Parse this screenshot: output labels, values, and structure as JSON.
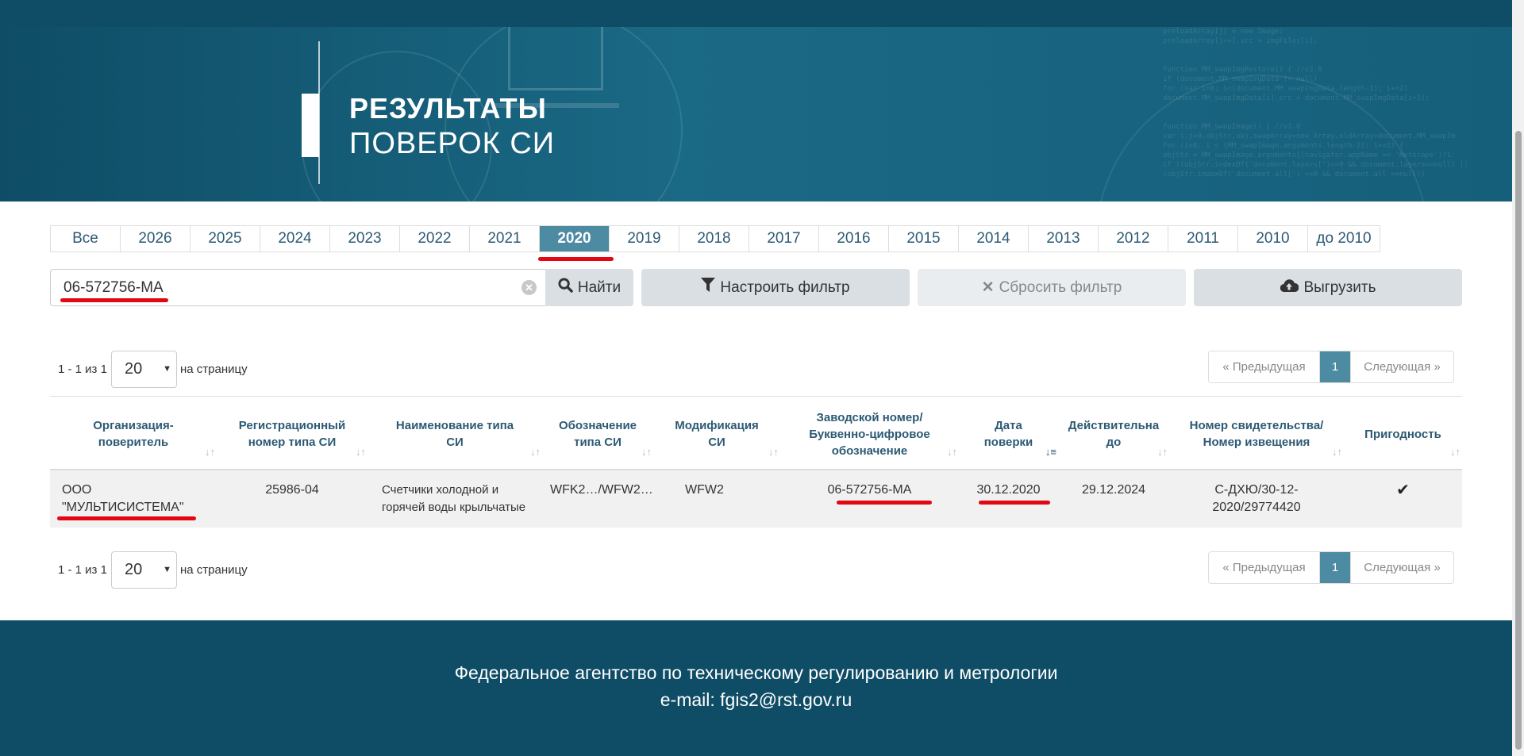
{
  "hero": {
    "title_line1": "РЕЗУЛЬТАТЫ",
    "title_line2": "ПОВЕРОК СИ"
  },
  "years": [
    "Все",
    "2026",
    "2025",
    "2024",
    "2023",
    "2022",
    "2021",
    "2020",
    "2019",
    "2018",
    "2017",
    "2016",
    "2015",
    "2014",
    "2013",
    "2012",
    "2011",
    "2010",
    "до 2010"
  ],
  "active_year": "2020",
  "search": {
    "value": "06-572756-МА",
    "find_label": "Найти"
  },
  "buttons": {
    "filter": "Настроить фильтр",
    "reset": "Сбросить фильтр",
    "export": "Выгрузить"
  },
  "pagination": {
    "count": "1 - 1 из 1",
    "page_size": "20",
    "per_page": "на страницу",
    "prev": "Предыдущая",
    "page": "1",
    "next": "Следующая"
  },
  "table": {
    "headers": [
      "Организация-\nповеритель",
      "Регистрационный\nномер типа СИ",
      "Наименование типа\nСИ",
      "Обозначение\nтипа СИ",
      "Модификация\nСИ",
      "Заводской номер/\nБуквенно-цифровое\nобозначение",
      "Дата\nповерки",
      "Действительна\nдо",
      "Номер свидетельства/\nНомер извещения",
      "Пригодность"
    ],
    "rows": [
      {
        "org": "ООО\n\"МУЛЬТИСИСТЕМА\"",
        "reg_number": "25986-04",
        "type_name": "Счетчики холодной и\nгорячей воды крыльчатые",
        "designation": "WFK2…/WFW2…",
        "modification": "WFW2",
        "serial": "06-572756-МА",
        "date": "30.12.2020",
        "valid_until": "29.12.2024",
        "certificate": "С-ДХЮ/30-12-\n2020/29774420",
        "suitable": "✔"
      }
    ]
  },
  "footer": {
    "line1": "Федеральное агентство по техническому регулированию и метрологии",
    "line2": "e-mail: fgis2@rst.gov.ru"
  },
  "colors": {
    "primary": "#0f4d66",
    "accent": "#4d8ba3",
    "highlight": "#e30613"
  },
  "icons": {
    "search": "search-icon",
    "filter": "filter-icon",
    "reset": "close-icon",
    "export": "cloud-upload-icon",
    "clear": "clear-input-icon",
    "suitable": "check-icon"
  }
}
